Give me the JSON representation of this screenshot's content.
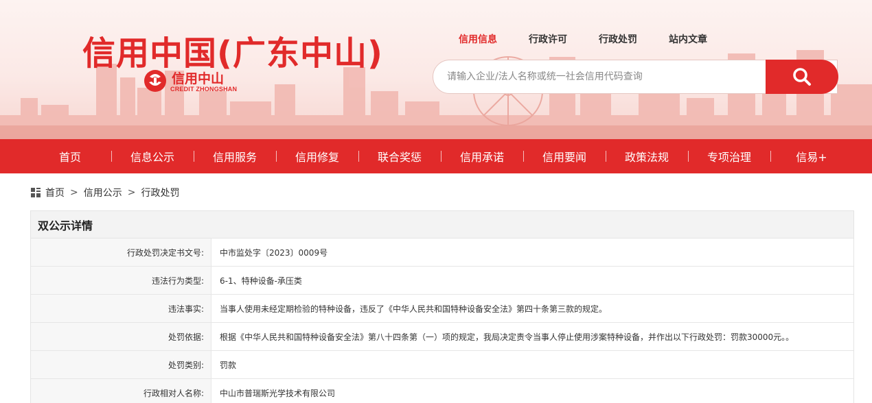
{
  "site": {
    "title": "信用中国(广东中山)",
    "logo_text": "信用中山",
    "logo_sub": "CREDIT ZHONGSHAN"
  },
  "search": {
    "tabs": [
      {
        "label": "信用信息",
        "active": true
      },
      {
        "label": "行政许可",
        "active": false
      },
      {
        "label": "行政处罚",
        "active": false
      },
      {
        "label": "站内文章",
        "active": false
      }
    ],
    "placeholder": "请输入企业/法人名称或统一社会信用代码查询",
    "value": "",
    "button_icon": "search-icon"
  },
  "nav": {
    "items": [
      "首页",
      "信息公示",
      "信用服务",
      "信用修复",
      "联合奖惩",
      "信用承诺",
      "信用要闻",
      "政策法规",
      "专项治理",
      "信易+"
    ]
  },
  "breadcrumb": {
    "icon": "grid-icon",
    "items": [
      "首页",
      "信用公示",
      "行政处罚"
    ],
    "separator": ">"
  },
  "detail": {
    "title": "双公示详情",
    "rows": [
      {
        "label": "行政处罚决定书文号:",
        "value": "中市监处字〔2023〕0009号"
      },
      {
        "label": "违法行为类型:",
        "value": "6-1、特种设备-承压类"
      },
      {
        "label": "违法事实:",
        "value": "当事人使用未经定期检验的特种设备，违反了《中华人民共和国特种设备安全法》第四十条第三款的规定。"
      },
      {
        "label": "处罚依据:",
        "value": "根据《中华人民共和国特种设备安全法》第八十四条第（一）项的规定，我局决定责令当事人停止使用涉案特种设备，并作出以下行政处罚：罚款30000元。。"
      },
      {
        "label": "处罚类别:",
        "value": "罚款"
      },
      {
        "label": "行政相对人名称:",
        "value": "中山市普瑞斯光学技术有限公司"
      }
    ]
  },
  "colors": {
    "brand_red": "#e12a2a",
    "panel_header_bg": "#f3f3f3",
    "label_bg": "#f7f7f7"
  }
}
